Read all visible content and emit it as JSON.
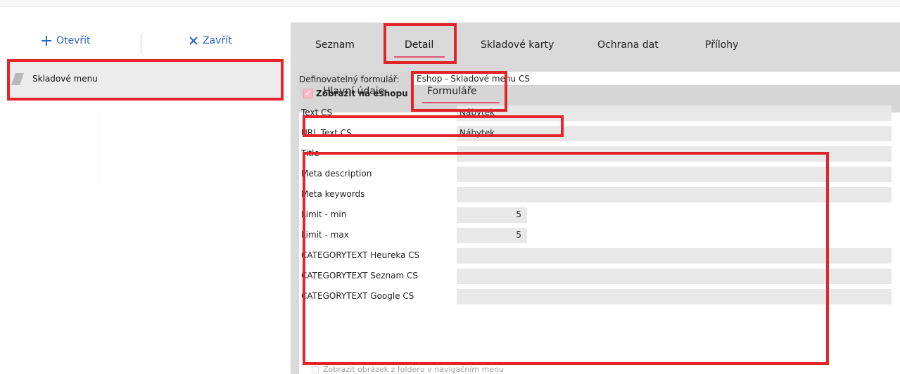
{
  "left_toolbar": {
    "open_label": "Otevřít",
    "close_label": "Zavřít"
  },
  "left_menu": {
    "item_label": "Skladové menu"
  },
  "main_tabs": [
    {
      "label": "Seznam",
      "active": false
    },
    {
      "label": "Detail",
      "active": true
    },
    {
      "label": "Skladové karty",
      "active": false
    },
    {
      "label": "Ochrana dat",
      "active": false
    },
    {
      "label": "Přílohy",
      "active": false
    }
  ],
  "sub_tabs": [
    {
      "label": "Hlavní údaje",
      "active": false
    },
    {
      "label": "Formuláře",
      "active": true
    }
  ],
  "form": {
    "label": "Definovatelný formulář:",
    "value": "Eshop - Skladové menu CS"
  },
  "checkbox": {
    "label": "Zobrazit na eshopu",
    "checked": true
  },
  "fields": [
    {
      "label": "Text CS",
      "value": "Nábytek"
    },
    {
      "label": "URL Text CS",
      "value": "Nábytek"
    },
    {
      "label": "Title",
      "value": ""
    },
    {
      "label": "Meta description",
      "value": ""
    },
    {
      "label": "Meta keywords",
      "value": ""
    },
    {
      "label": "Limit - min",
      "value": "5"
    },
    {
      "label": "Limit - max",
      "value": "5"
    },
    {
      "label": "CATEGORYTEXT Heureka CS",
      "value": ""
    },
    {
      "label": "CATEGORYTEXT Seznam CS",
      "value": ""
    },
    {
      "label": "CATEGORYTEXT Google CS",
      "value": ""
    }
  ],
  "bottom_checkbox_label": "Zobrazit obrázek z folderu v navigačním menu",
  "colors": {
    "accent_blue": "#2a62c9",
    "highlight_red": "#e3242b",
    "tab_underline": "#e05577"
  }
}
